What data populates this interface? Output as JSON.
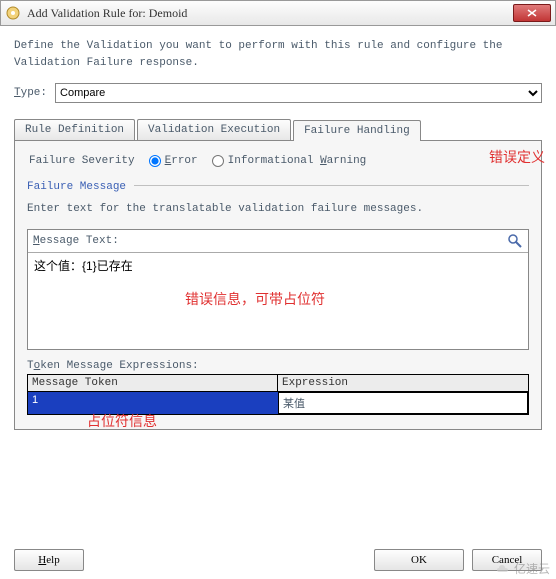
{
  "window": {
    "title": "Add Validation Rule for: Demoid"
  },
  "description": "Define the Validation you want to perform with this rule and configure the Validation Failure response.",
  "type": {
    "label": "Type:",
    "value": "Compare"
  },
  "tabs": {
    "rule": "Rule Definition",
    "exec": "Validation Execution",
    "fail": "Failure Handling"
  },
  "severity": {
    "label": "Failure Severity",
    "error": "Error",
    "info": "Informational Warning"
  },
  "failure_msg": {
    "section": "Failure Message",
    "hint": "Enter text for the translatable validation failure messages.",
    "text_label": "Message Text:",
    "text_value": "这个值：{1}已存在"
  },
  "tokens": {
    "label": "Token Message Expressions:",
    "col1": "Message Token",
    "col2": "Expression",
    "row": {
      "token": "1",
      "expr": "某值"
    }
  },
  "annotations": {
    "a1": "错误定义",
    "a2": "错误信息，可带占位符",
    "a3": "占位符信息"
  },
  "buttons": {
    "help": "Help",
    "ok": "OK",
    "cancel": "Cancel"
  },
  "watermark": "亿速云"
}
